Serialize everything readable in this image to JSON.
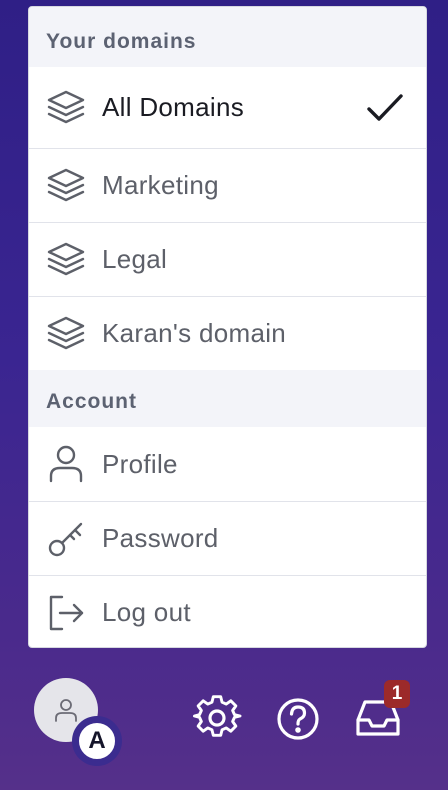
{
  "menu": {
    "domains_header": "Your domains",
    "domains": [
      {
        "label": "All Domains",
        "icon": "layers-icon",
        "selected": true
      },
      {
        "label": "Marketing",
        "icon": "layers-icon",
        "selected": false
      },
      {
        "label": "Legal",
        "icon": "layers-icon",
        "selected": false
      },
      {
        "label": "Karan's domain",
        "icon": "layers-icon",
        "selected": false
      }
    ],
    "account_header": "Account",
    "account": [
      {
        "label": "Profile",
        "icon": "user-icon"
      },
      {
        "label": "Password",
        "icon": "key-icon"
      },
      {
        "label": "Log out",
        "icon": "logout-icon"
      }
    ]
  },
  "bottom_bar": {
    "avatar_badge_letter": "A",
    "inbox_count": "1",
    "icons": [
      "user-icon",
      "gear-icon",
      "help-icon",
      "inbox-icon"
    ]
  },
  "colors": {
    "background": "#3a2591",
    "badge": "#9c2a2a",
    "check": "#1a1b22"
  }
}
